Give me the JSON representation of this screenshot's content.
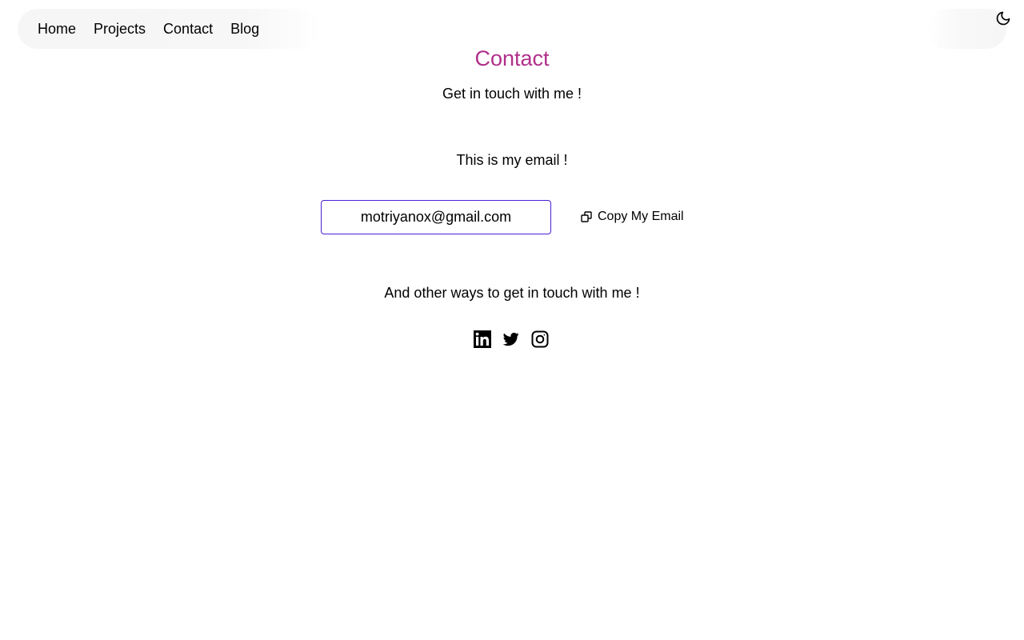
{
  "nav": {
    "items": [
      {
        "label": "Home"
      },
      {
        "label": "Projects"
      },
      {
        "label": "Contact"
      },
      {
        "label": "Blog"
      }
    ],
    "theme_toggle_icon": "moon-icon"
  },
  "contact": {
    "title": "Contact",
    "subtitle": "Get in touch with me !",
    "email_intro": "This is my email !",
    "email": "motriyanox@gmail.com",
    "copy_label": "Copy My Email",
    "copy_icon": "copy-icon",
    "other_ways": "And other ways to get in touch with me !",
    "socials": [
      {
        "icon": "linkedin-icon"
      },
      {
        "icon": "twitter-icon"
      },
      {
        "icon": "instagram-icon"
      }
    ]
  },
  "colors": {
    "title": "#b0308a",
    "email_border": "#4a1fd6",
    "text": "#000000",
    "nav_bg": "#f6f6f6"
  }
}
